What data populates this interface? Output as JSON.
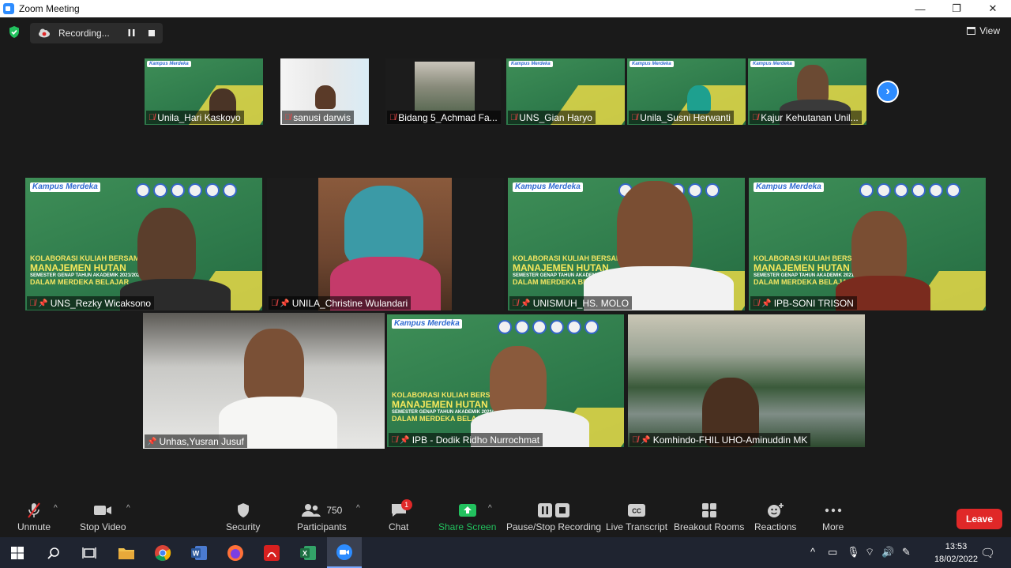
{
  "window": {
    "title": "Zoom Meeting",
    "min": "—",
    "max": "❐",
    "close": "✕"
  },
  "recording": {
    "label": "Recording..."
  },
  "view": {
    "label": "View"
  },
  "participants_tiles": {
    "row1": [
      {
        "name": "Unila_Hari Kaskoyo"
      },
      {
        "name": "sanusi darwis"
      },
      {
        "name": "Bidang 5_Achmad Fa..."
      },
      {
        "name": "UNS_Gian Haryo"
      },
      {
        "name": "Unila_Susni Herwanti"
      },
      {
        "name": "Kajur Kehutanan Unil..."
      }
    ],
    "row2": [
      {
        "name": "UNS_Rezky Wicaksono"
      },
      {
        "name": "UNILA_Christine Wulandari"
      },
      {
        "name": "UNISMUH_HS. MOLO"
      },
      {
        "name": "IPB-SONI TRISON"
      }
    ],
    "row3": [
      {
        "name": "Unhas,Yusran Jusuf"
      },
      {
        "name": "IPB - Dodik Ridho Nurrochmat"
      },
      {
        "name": "Komhindo-FHIL UHO-Aminuddin MK"
      }
    ]
  },
  "banner": {
    "kampus": "Kampus Merdeka",
    "line1": "KOLABORASI KULIAH BERSAMA",
    "line2": "MANAJEMEN HUTAN",
    "line3": "SEMESTER GENAP TAHUN AKADEMIK 2021/2022",
    "line4": "DALAM MERDEKA BELAJAR"
  },
  "toolbar": {
    "unmute": "Unmute",
    "stop_video": "Stop Video",
    "security": "Security",
    "participants": "Participants",
    "participants_count": "750",
    "chat": "Chat",
    "chat_badge": "1",
    "share_screen": "Share Screen",
    "pause_stop_recording": "Pause/Stop Recording",
    "live_transcript": "Live Transcript",
    "breakout_rooms": "Breakout Rooms",
    "reactions": "Reactions",
    "more": "More",
    "leave": "Leave"
  },
  "taskbar": {
    "time": "13:53",
    "date": "18/02/2022"
  },
  "colors": {
    "accent": "#2d8cff",
    "leave": "#e02828",
    "share": "#22c15e",
    "active_speaker": "#d7e36a"
  }
}
